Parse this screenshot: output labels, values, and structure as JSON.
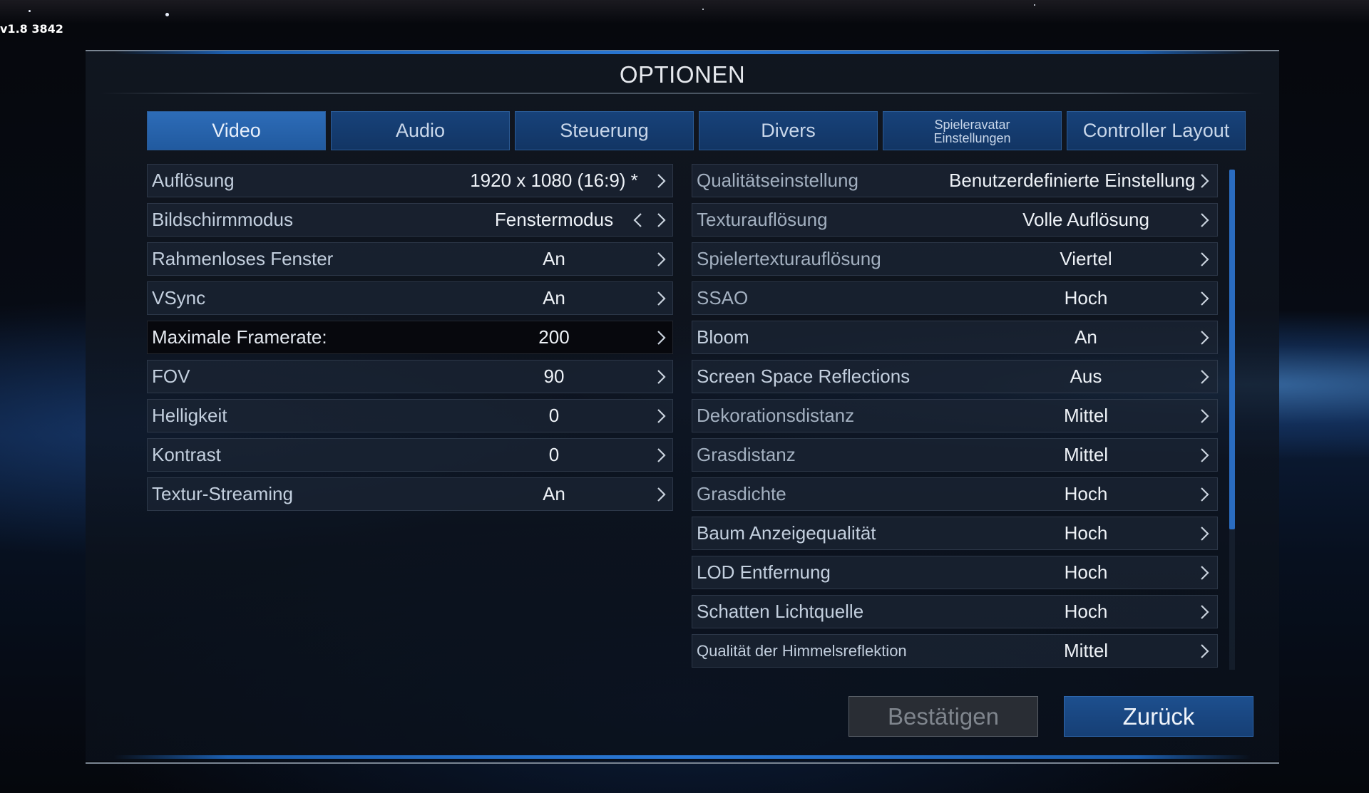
{
  "version": "v1.8 3842",
  "title": "OPTIONEN",
  "tabs": [
    {
      "label": "Video",
      "active": true
    },
    {
      "label": "Audio",
      "active": false
    },
    {
      "label": "Steuerung",
      "active": false
    },
    {
      "label": "Divers",
      "active": false
    },
    {
      "label": "Spieleravatar Einstellungen",
      "line1": "Spieleravatar",
      "line2": "Einstellungen",
      "active": false
    },
    {
      "label": "Controller Layout",
      "active": false
    }
  ],
  "left_settings": [
    {
      "label": "Auflösung",
      "value": "1920 x 1080  (16:9)  *"
    },
    {
      "label": "Bildschirmmodus",
      "value": "Fenstermodus"
    },
    {
      "label": "Rahmenloses Fenster",
      "value": "An"
    },
    {
      "label": "VSync",
      "value": "An"
    },
    {
      "label": "Maximale Framerate:",
      "value": "200"
    },
    {
      "label": "FOV",
      "value": "90"
    },
    {
      "label": "Helligkeit",
      "value": "0"
    },
    {
      "label": "Kontrast",
      "value": "0"
    },
    {
      "label": "Textur-Streaming",
      "value": "An"
    }
  ],
  "right_settings": [
    {
      "label": "Qualitätseinstellung",
      "value": "Benutzerdefinierte Einstellung"
    },
    {
      "label": "Texturauflösung",
      "value": "Volle Auflösung"
    },
    {
      "label": "Spielertexturauflösung",
      "value": "Viertel"
    },
    {
      "label": "SSAO",
      "value": "Hoch"
    },
    {
      "label": "Bloom",
      "value": "An"
    },
    {
      "label": "Screen Space Reflections",
      "value": "Aus"
    },
    {
      "label": "Dekorationsdistanz",
      "value": "Mittel"
    },
    {
      "label": "Grasdistanz",
      "value": "Mittel"
    },
    {
      "label": "Grasdichte",
      "value": "Hoch"
    },
    {
      "label": "Baum Anzeigequalität",
      "value": "Hoch"
    },
    {
      "label": "LOD Entfernung",
      "value": "Hoch"
    },
    {
      "label": "Schatten Lichtquelle",
      "value": "Hoch"
    },
    {
      "label": "Qualität der Himmelsreflektion",
      "value": "Mittel"
    }
  ],
  "buttons": {
    "confirm_label": "Bestätigen",
    "back_label": "Zurück"
  },
  "colors": {
    "accent_blue": "#2d6cb8",
    "tab_blue": "#17427a",
    "text_light": "#eef2f7"
  },
  "icons": {
    "chevron_right": "chevron-right-icon",
    "chevron_left": "chevron-left-icon"
  }
}
